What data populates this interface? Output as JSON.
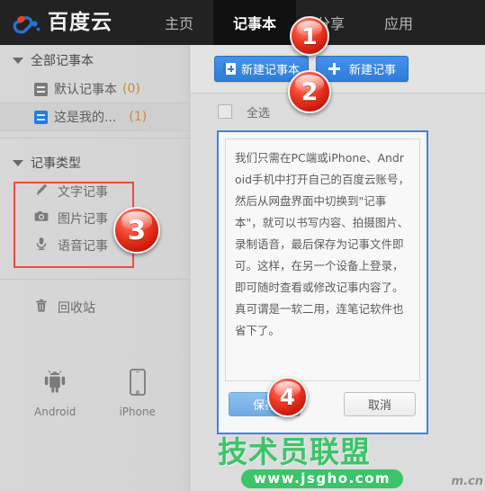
{
  "topnav": {
    "brand": "百度云",
    "brand_logo_icon": "baidu-cloud-paw-logo",
    "items": [
      {
        "label": "主页",
        "active": false
      },
      {
        "label": "记事本",
        "active": true
      },
      {
        "label": "分享",
        "active": false
      },
      {
        "label": "应用",
        "active": false
      }
    ]
  },
  "sidebar": {
    "notebooks_group": {
      "label": "全部记事本",
      "caret_icon": "caret-down-icon",
      "items": [
        {
          "label": "默认记事本",
          "count": "(0)",
          "icon": "notebook-icon-gray",
          "selected": false
        },
        {
          "label": "这是我的...",
          "count": "(1)",
          "icon": "notebook-icon-blue",
          "selected": true
        }
      ]
    },
    "types_group": {
      "label": "记事类型",
      "caret_icon": "caret-down-icon",
      "items": [
        {
          "label": "文字记事",
          "icon": "pencil-icon"
        },
        {
          "label": "图片记事",
          "icon": "camera-icon"
        },
        {
          "label": "语音记事",
          "icon": "microphone-icon"
        }
      ]
    },
    "trash": {
      "label": "回收站",
      "icon": "trash-icon"
    },
    "devices": [
      {
        "label": "Android",
        "icon": "android-icon"
      },
      {
        "label": "iPhone",
        "icon": "iphone-icon"
      }
    ]
  },
  "main": {
    "toolbar": {
      "new_notebook_label": "新建记事本",
      "new_notebook_icon": "notebook-plus-icon",
      "new_note_label": "新建记事",
      "new_note_icon": "plus-icon"
    },
    "select_all": {
      "label": "全选",
      "checked": false
    },
    "editor": {
      "content": "我们只需在PC端或iPhone、Android手机中打开自己的百度云账号，然后从网盘界面中切换到\"记事本\"，就可以书写内容、拍摄图片、录制语音，最后保存为记事文件即可。这样，在另一个设备上登录，即可随时查看或修改记事内容了。真可谓是一软二用，连笔记软件也省下了。",
      "save_label": "保存",
      "cancel_label": "取消"
    }
  },
  "markers": [
    {
      "number": "1"
    },
    {
      "number": "2"
    },
    {
      "number": "3"
    },
    {
      "number": "4"
    }
  ],
  "watermark": {
    "title": "技术员联盟",
    "url": "www.jsgho.com",
    "tail": "m.cn"
  },
  "colors": {
    "nav_bg": "#222222",
    "nav_active_bg": "#111111",
    "accent_blue": "#2f7ddb",
    "highlight_red": "#ed4c43",
    "count_orange": "#c98a3c",
    "watermark_green": "#3cc46a"
  }
}
